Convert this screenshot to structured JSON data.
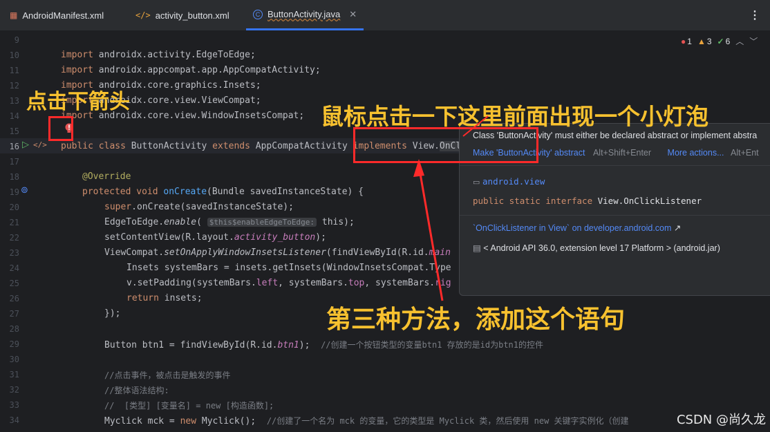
{
  "tabs": [
    {
      "label": "AndroidManifest.xml",
      "icon": "xml-icon"
    },
    {
      "label": "activity_button.xml",
      "icon": "code-icon"
    },
    {
      "label": "ButtonActivity.java",
      "icon": "class-icon",
      "active": true
    }
  ],
  "inspections": {
    "errors": "1",
    "warnings": "3",
    "ok": "6"
  },
  "lines": [
    "9",
    "10",
    "11",
    "12",
    "13",
    "14",
    "15",
    "16",
    "17",
    "18",
    "19",
    "20",
    "21",
    "22",
    "23",
    "24",
    "25",
    "26",
    "27",
    "28",
    "29",
    "30",
    "31",
    "32",
    "33",
    "34"
  ],
  "code": {
    "l10_kw": "import",
    "l10": " androidx.activity.EdgeToEdge;",
    "l11_kw": "import",
    "l11": " androidx.appcompat.app.AppCompatActivity;",
    "l12_kw": "import",
    "l12": " androidx.core.graphics.Insets;",
    "l13_kw": "import",
    "l13": " androidx.core.view.ViewCompat;",
    "l14_kw": "import",
    "l14": " androidx.core.view.WindowInsetsCompat;",
    "l16_a": "public class ",
    "l16_b": "ButtonActivity ",
    "l16_c": "extends ",
    "l16_d": "AppCompatActivity ",
    "l16_e": "implements ",
    "l16_f": "View.",
    "l16_g": "OnClickListener",
    "l18": "@Override",
    "l19_a": "protected void ",
    "l19_b": "onCreate",
    "l19_c": "(Bundle savedInstanceState) {",
    "l20_a": "super",
    "l20_b": ".onCreate(savedInstanceState);",
    "l21_a": "EdgeToEdge.",
    "l21_b": "enable",
    "l21_c": "( ",
    "l21_hint": "$this$enableEdgeToEdge:",
    "l21_d": " this);",
    "l22_a": "setContentView(R.layout.",
    "l22_b": "activity_button",
    "l22_c": ");",
    "l23_a": "ViewCompat.",
    "l23_b": "setOnApplyWindowInsetsListener",
    "l23_c": "(findViewById(R.id.",
    "l23_d": "main",
    "l24": "Insets systemBars = insets.getInsets(WindowInsetsCompat.Type",
    "l25_a": "v.setPadding(systemBars.",
    "l25_b": "left",
    "l25_c": ", systemBars.",
    "l25_d": "top",
    "l25_e": ", systemBars.",
    "l25_f": "rig",
    "l26_a": "return",
    "l26_b": " insets;",
    "l27": "});",
    "l29_a": "Button btn1 = findViewById(R.id.",
    "l29_b": "btn1",
    "l29_c": ");  ",
    "l29_cm": "//创建一个按钮类型的变量btn1 存放的是id为btn1的控件",
    "l31": "//点击事件，被点击是触发的事件",
    "l32": "//整体语法结构:",
    "l33": "//  [类型] [变量名] = new [构造函数];",
    "l34_a": "Myclick mck = ",
    "l34_b": "new",
    "l34_c": " Myclick();  ",
    "l34_cm": "//创建了一个名为 mck 的变量，它的类型是 Myclick 类，然后使用 new 关键字实例化（创建"
  },
  "popup": {
    "message": "Class 'ButtonActivity' must either be declared abstract or implement abstra",
    "action1": "Make 'ButtonActivity' abstract",
    "action1_key": "Alt+Shift+Enter",
    "action2": "More actions...",
    "action2_key": "Alt+Ent",
    "package": "android.view",
    "declaration_a": "public static interface ",
    "declaration_b": "View.OnClickListener",
    "doc_link": "`OnClickListener in View` on developer.android.com",
    "doc_arrow": "↗",
    "sdk": "< Android API 36.0, extension level 17 Platform > (android.jar)"
  },
  "annotations": {
    "click_arrow": "点击下箭头",
    "click_here": "鼠标点击一下这里前面出现一个小灯泡",
    "third_method": "第三种方法，添加这个语句"
  },
  "watermark": "CSDN @尚久龙",
  "colors": {
    "annotation": "#f7c12f",
    "highlight_box": "#ff2a2a",
    "accent": "#3574f0"
  }
}
